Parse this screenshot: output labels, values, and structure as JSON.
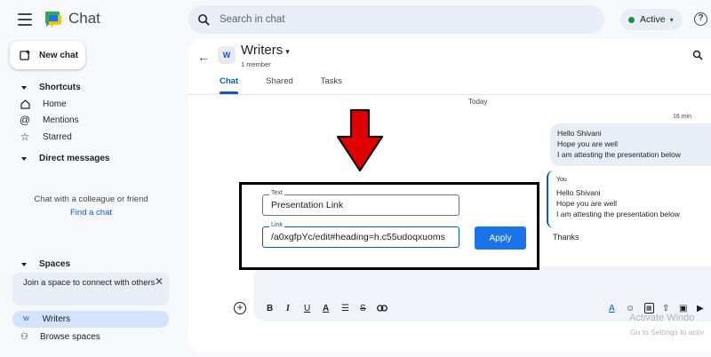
{
  "app": {
    "title": "Chat"
  },
  "search": {
    "placeholder": "Search in chat"
  },
  "status": {
    "label": "Active",
    "color": "#1e8e3e"
  },
  "sidebar": {
    "new_chat_label": "New chat",
    "shortcuts_label": "Shortcuts",
    "shortcuts": [
      {
        "label": "Home",
        "icon": "home-icon"
      },
      {
        "label": "Mentions",
        "icon": "at-sign-icon"
      },
      {
        "label": "Starred",
        "icon": "star-icon"
      }
    ],
    "direct_messages_label": "Direct messages",
    "dm_empty_text": "Chat with a colleague or friend",
    "find_chat_label": "Find a chat",
    "spaces_label": "Spaces",
    "join_text": "Join a space to connect with others",
    "space": {
      "badge": "W",
      "label": "Writers"
    },
    "browse_label": "Browse spaces"
  },
  "room": {
    "avatar": "W",
    "title": "Writers",
    "subtitle": "1 member",
    "tabs": [
      {
        "label": "Chat",
        "active": true
      },
      {
        "label": "Shared",
        "active": false
      },
      {
        "label": "Tasks",
        "active": false
      }
    ]
  },
  "conversation": {
    "day": "Today",
    "time": "16 min",
    "message1": [
      "Hello Shivani",
      "Hope you are well",
      "I am attesting the presentation below"
    ],
    "reply": {
      "quoted_author": "You",
      "quoted_lines": [
        "Hello Shivani",
        "Hope you are well",
        "I am attesting the presentation below"
      ],
      "text": "Thanks"
    }
  },
  "link_dialog": {
    "text_label": "Text",
    "text_value": "Presentation Link",
    "link_label": "Link",
    "link_value": "/a0xgfpYc/edit#heading=h.c55udoqxuoms",
    "apply_label": "Apply"
  },
  "composer": {
    "tools": [
      "bold-icon",
      "italic-icon",
      "underline-icon",
      "text-color-icon",
      "bulleted-list-icon",
      "strikethrough-icon",
      "link-icon"
    ],
    "bold": "B",
    "italic": "I",
    "underline": "U",
    "strikethrough": "S",
    "format": "A"
  },
  "watermark": {
    "line1": "Activate Windo",
    "line2": "Go to Settings to activ"
  },
  "colors": {
    "accent": "#0b57d0",
    "apply_button": "#1a73e8",
    "arrow": "#e00000"
  }
}
